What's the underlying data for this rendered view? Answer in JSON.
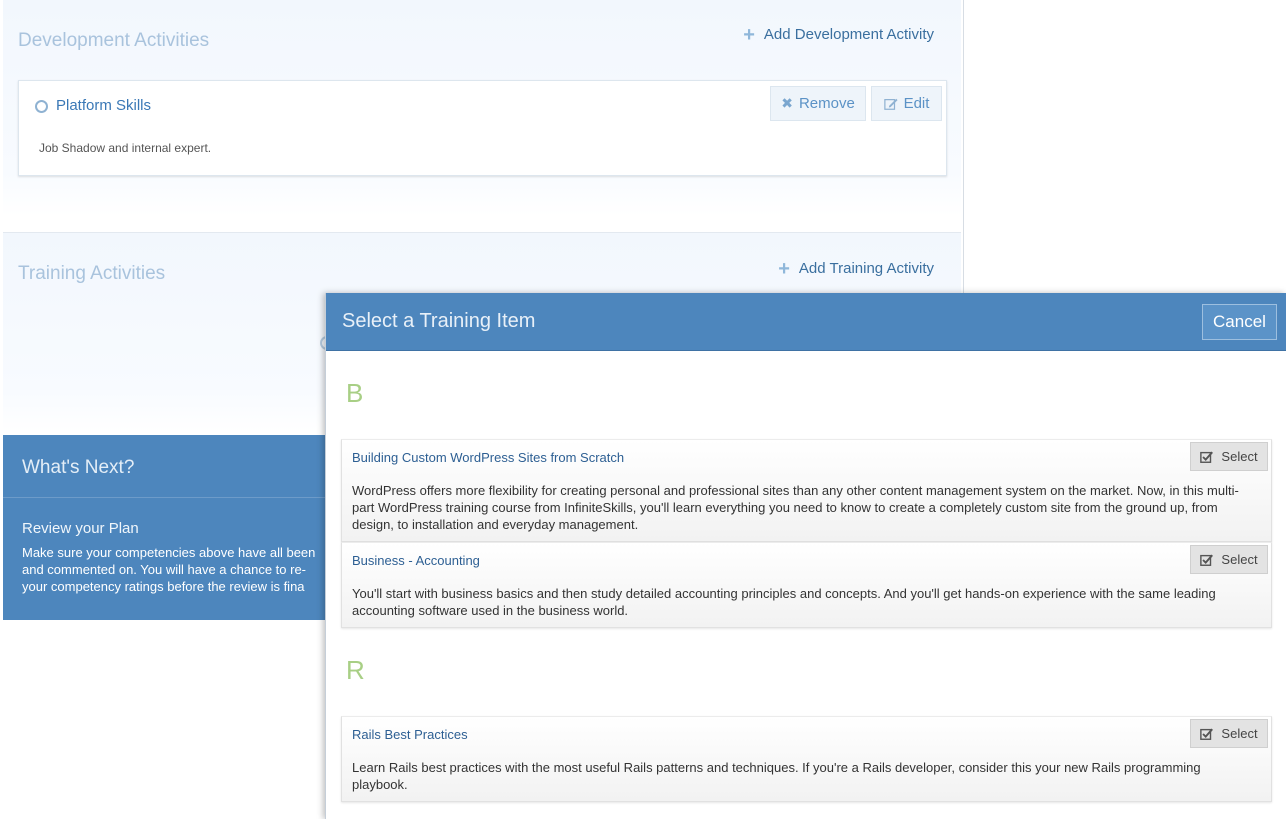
{
  "dev": {
    "title": "Development Activities",
    "add_label": "Add Development Activity",
    "activity": {
      "title": "Platform Skills",
      "description": "Job Shadow and internal expert.",
      "remove_label": "Remove",
      "edit_label": "Edit"
    }
  },
  "training": {
    "title": "Training Activities",
    "add_label": "Add Training Activity"
  },
  "next": {
    "title": "What's Next?",
    "review_title": "Review your Plan",
    "review_line1": "Make sure your competencies above have all been",
    "review_line2": "and commented on. You will have a chance to re-",
    "review_line3": "your competency ratings before the review is fina"
  },
  "modal": {
    "title": "Select a Training Item",
    "cancel_label": "Cancel",
    "groups": [
      {
        "letter": "B",
        "items": [
          {
            "title": "Building Custom WordPress Sites from Scratch",
            "description": "WordPress offers more flexibility for creating personal and professional sites than any other content management system on the market. Now, in this multi-part WordPress training course from InfiniteSkills, you'll learn everything you need to know to create a completely custom site from the ground up, from design, to installation and everyday management.",
            "select_label": "Select"
          },
          {
            "title": "Business - Accounting",
            "description": "You'll start with business basics and then study detailed accounting principles and concepts. And you'll get hands-on experience with the same leading accounting software used in the business world.",
            "select_label": "Select"
          }
        ]
      },
      {
        "letter": "R",
        "items": [
          {
            "title": "Rails Best Practices",
            "description": "Learn Rails best practices with the most useful Rails patterns and techniques. If you're a Rails developer, consider this your new Rails programming playbook.",
            "select_label": "Select"
          }
        ]
      }
    ]
  },
  "colors": {
    "header_blue": "#4d86bd",
    "link_blue": "#3a78b6",
    "letter_green": "#a8cf85"
  }
}
